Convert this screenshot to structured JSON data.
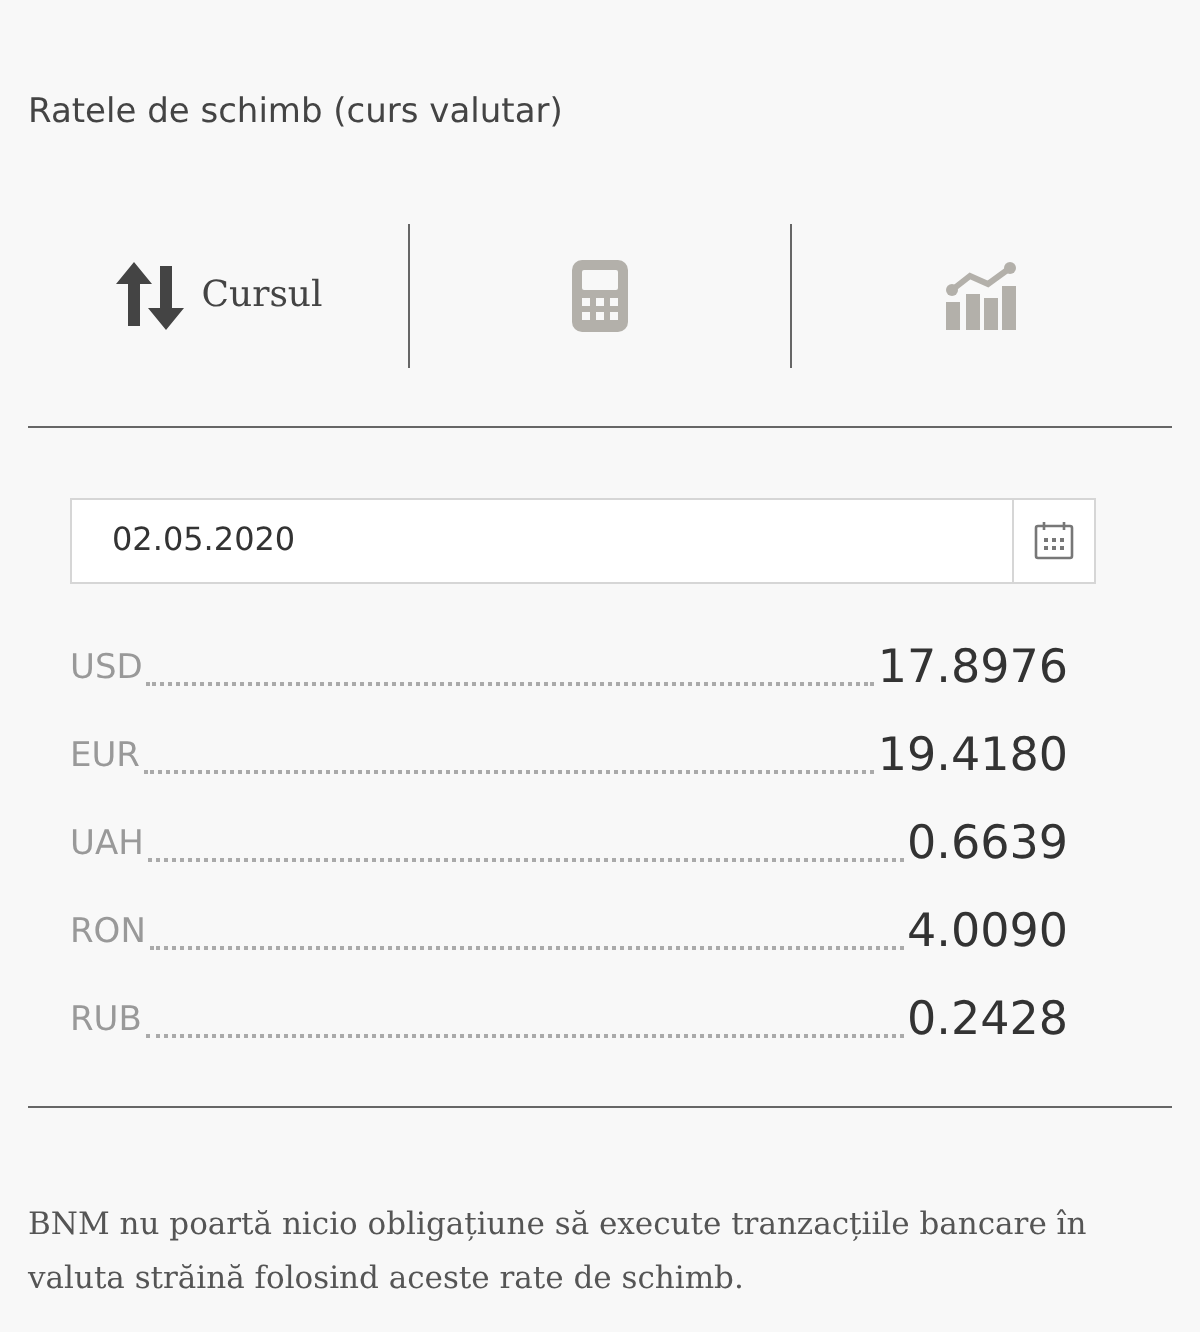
{
  "title": "Ratele de schimb (curs valutar)",
  "tabs": [
    {
      "kind": "arrows",
      "label": "Cursul",
      "selected": true
    },
    {
      "kind": "calculator",
      "selected": false
    },
    {
      "kind": "chart",
      "selected": false
    }
  ],
  "date_field": {
    "value": "02.05.2020"
  },
  "rates": [
    {
      "currency": "USD",
      "value": "17.8976"
    },
    {
      "currency": "EUR",
      "value": "19.4180"
    },
    {
      "currency": "UAH",
      "value": "0.6639"
    },
    {
      "currency": "RON",
      "value": "4.0090"
    },
    {
      "currency": "RUB",
      "value": "0.2428"
    }
  ],
  "note": "BNM nu poartă nicio obligațiune să execute tranzacțiile bancare în valuta străină folosind aceste rate de schimb."
}
